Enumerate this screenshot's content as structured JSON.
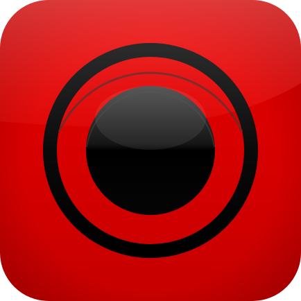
{
  "icon": {
    "symbol": "record-icon",
    "colors": {
      "background": "#d90000",
      "background_dark": "#b80000",
      "gloss": "#ff6a6a",
      "ring": "#0d0d0d",
      "ring_highlight": "#3a3a3a",
      "center": "#050505",
      "center_highlight": "#4a4a4a"
    }
  }
}
